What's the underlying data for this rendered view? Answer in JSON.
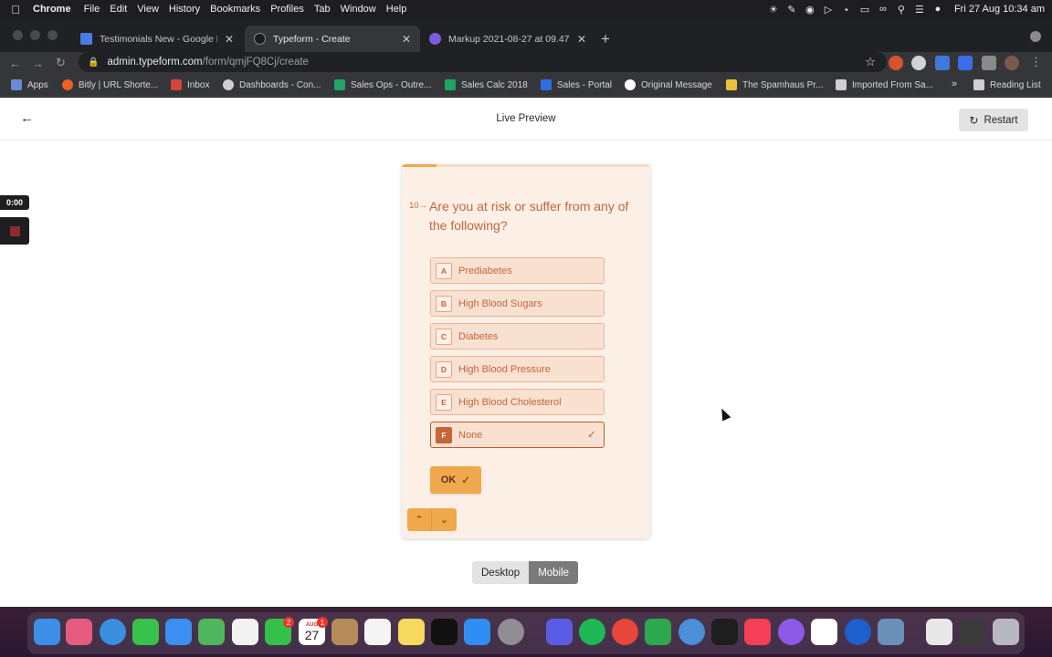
{
  "menubar": {
    "app": "Chrome",
    "items": [
      "File",
      "Edit",
      "View",
      "History",
      "Bookmarks",
      "Profiles",
      "Tab",
      "Window",
      "Help"
    ],
    "clock": "Fri 27 Aug  10:34 am"
  },
  "tabs": [
    {
      "title": "Testimonials New - Google Do",
      "color": "#4a7ce6"
    },
    {
      "title": "Typeform - Create",
      "color": "#1b1b1b"
    },
    {
      "title": "Markup 2021-08-27 at 09.47.",
      "color": "#7b5ce0"
    }
  ],
  "omnibox": {
    "host": "admin.typeform.com",
    "path": "/form/qmjFQ8Cj/create"
  },
  "bookmarks": [
    {
      "label": "Apps",
      "color": "#6b8bd6"
    },
    {
      "label": "Bitly | URL Shorte...",
      "color": "#ee6123"
    },
    {
      "label": "Inbox",
      "color": "#d44638"
    },
    {
      "label": "Dashboards - Con...",
      "color": "#cfcfcf"
    },
    {
      "label": "Sales Ops - Outre...",
      "color": "#21a464"
    },
    {
      "label": "Sales Calc 2018",
      "color": "#21a464"
    },
    {
      "label": "Sales - Portal",
      "color": "#2d6fe0"
    },
    {
      "label": "Original Message",
      "color": "#ffffff"
    },
    {
      "label": "The Spamhaus Pr...",
      "color": "#e8c23a"
    },
    {
      "label": "Imported From Sa...",
      "color": "#cfcfcf"
    },
    {
      "label": "Reading List",
      "color": "#cfcfcf"
    }
  ],
  "header": {
    "title": "Live Preview",
    "restart_label": "Restart"
  },
  "recorder": {
    "timer": "0:00"
  },
  "form": {
    "progress": 0.14,
    "question_number": "10",
    "question": "Are you at risk or suffer from any of the following?",
    "choices": [
      {
        "key": "A",
        "label": "Prediabetes",
        "selected": false
      },
      {
        "key": "B",
        "label": "High Blood Sugars",
        "selected": false
      },
      {
        "key": "C",
        "label": "Diabetes",
        "selected": false
      },
      {
        "key": "D",
        "label": "High Blood Pressure",
        "selected": false
      },
      {
        "key": "E",
        "label": "High Blood Cholesterol",
        "selected": false
      },
      {
        "key": "F",
        "label": "None",
        "selected": true
      }
    ],
    "ok_label": "OK"
  },
  "view_toggle": {
    "desktop_label": "Desktop",
    "mobile_label": "Mobile",
    "active": "Mobile"
  },
  "dock": {
    "facetime_badge": "2",
    "calendar_month": "AUG",
    "calendar_day": "27",
    "calendar_badge": "1"
  }
}
